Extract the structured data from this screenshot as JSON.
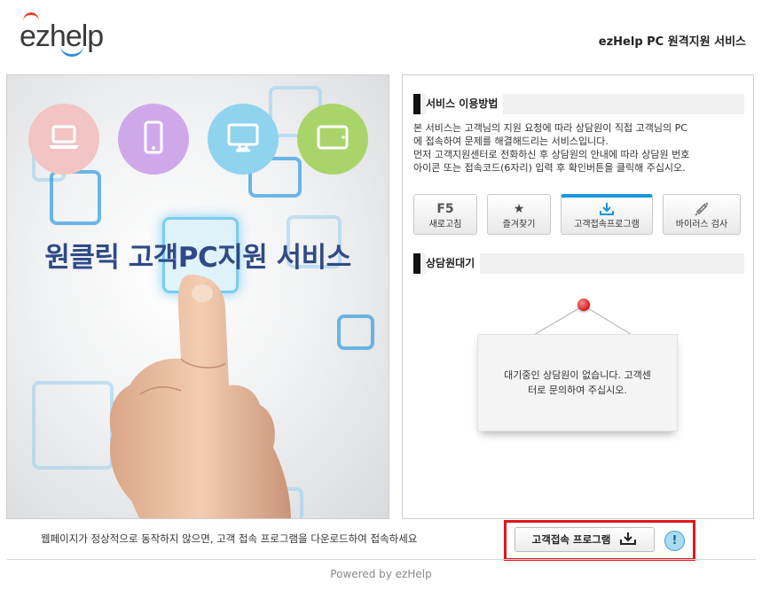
{
  "header": {
    "logo_text": "ezhelp",
    "service_title": "ezHelp PC 원격지원 서비스"
  },
  "hero": {
    "title": "원클릭 고객PC지원 서비스",
    "device_icons": [
      {
        "icon": "laptop-icon",
        "color": "#f2c4c4"
      },
      {
        "icon": "smartphone-icon",
        "color": "#cfa8ea"
      },
      {
        "icon": "monitor-icon",
        "color": "#8fd3ef"
      },
      {
        "icon": "tablet-icon",
        "color": "#a9d46a"
      }
    ]
  },
  "usage": {
    "heading": "서비스 이용방법",
    "desc_line1": "본 서비스는 고객님의 지원 요청에 따라 상담원이 직접 고객님의 PC",
    "desc_line2": "에 접속하여 문제를 해결해드리는 서비스입니다.",
    "desc_line3": "먼저 고객지원센터로 전화하신 후 상담원의 안내에 따라 상담원 번호",
    "desc_line4": "아이콘 또는 접속코드(6자리) 입력 후 확인버튼을 클릭해 주십시오."
  },
  "tools": [
    {
      "icon_text": "F5",
      "label": "새로고침",
      "icon": "refresh-f5-icon"
    },
    {
      "icon_text": "★",
      "label": "즐겨찾기",
      "icon": "star-icon"
    },
    {
      "icon_text": "",
      "label": "고객접속프로그램",
      "icon": "download-icon"
    },
    {
      "icon_text": "",
      "label": "바이러스 검사",
      "icon": "syringe-icon"
    }
  ],
  "waiting": {
    "heading": "상담원대기",
    "empty_line1": "대기중인 상담원이 없습니다. 고객센",
    "empty_line2": "터로 문의하여 주십시오."
  },
  "bottom": {
    "message": "웹페이지가 정상적으로 동작하지 않으면, 고객 접속 프로그램을 다운로드하여 접속하세요",
    "download_label": "고객접속 프로그램",
    "info_label": "!"
  },
  "footer": {
    "powered": "Powered by ezHelp"
  },
  "colors": {
    "accent": "#1a97d8",
    "hero_title": "#2f4a86",
    "highlight_box": "#e0161c"
  }
}
